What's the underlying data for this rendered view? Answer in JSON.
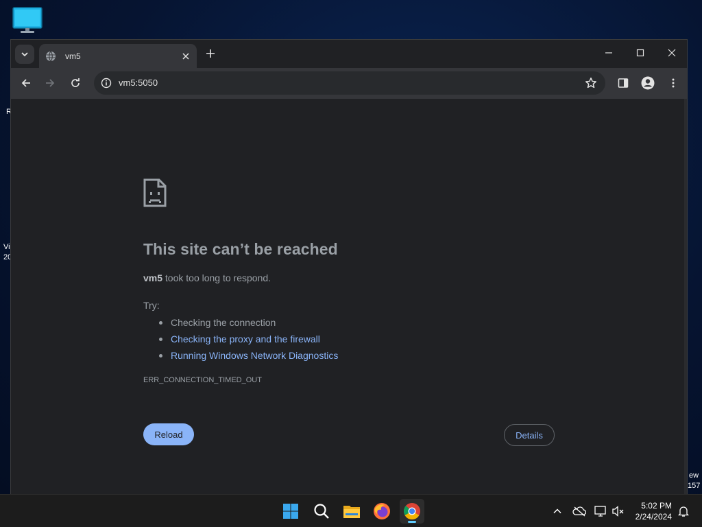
{
  "desktop": {
    "edge_text_left": [
      "R",
      "Vi",
      "20"
    ],
    "edge_text_right": [
      "ew",
      "157"
    ]
  },
  "browser": {
    "tab": {
      "title": "vm5"
    },
    "address_bar": {
      "url": "vm5:5050"
    }
  },
  "error_page": {
    "title": "This site can’t be reached",
    "host": "vm5",
    "description": " took too long to respond.",
    "try_label": "Try:",
    "suggestions": [
      "Checking the connection",
      "Checking the proxy and the firewall",
      "Running Windows Network Diagnostics"
    ],
    "error_code": "ERR_CONNECTION_TIMED_OUT",
    "reload_label": "Reload",
    "details_label": "Details"
  },
  "taskbar": {
    "apps": [
      "start-icon",
      "search-icon",
      "file-explorer-icon",
      "firefox-icon",
      "chrome-icon"
    ],
    "clock": {
      "time": "5:02 PM",
      "date": "2/24/2024"
    }
  },
  "colors": {
    "accent_link": "#8ab4f8",
    "page_bg": "#202124",
    "toolbar_bg": "#35363a"
  }
}
